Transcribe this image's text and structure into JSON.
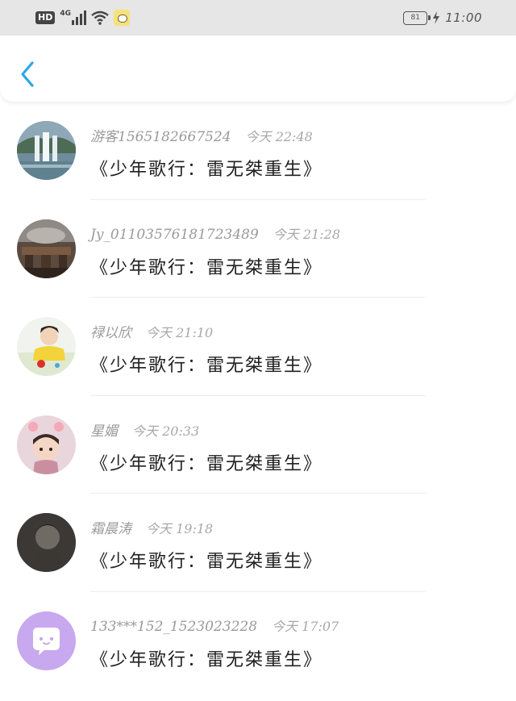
{
  "status_bar": {
    "hd_label": "HD",
    "network_label": "4G",
    "battery_level": "81",
    "time": "11:00"
  },
  "header": {
    "back_icon": "chevron-left-icon",
    "accent": "#2aa7e8"
  },
  "messages": [
    {
      "name": "游客1565182667524",
      "time": "今天 22:48",
      "text": "《少年歌行：雷无桀重生》",
      "avatar": "waterfall-photo"
    },
    {
      "name": "Jy_01103576181723489",
      "time": "今天 21:28",
      "text": "《少年歌行：雷无桀重生》",
      "avatar": "room-photo"
    },
    {
      "name": "禄以欣",
      "time": "今天 21:10",
      "text": "《少年歌行：雷无桀重生》",
      "avatar": "child-photo"
    },
    {
      "name": "星媚",
      "time": "今天 20:33",
      "text": "《少年歌行：雷无桀重生》",
      "avatar": "girl-photo"
    },
    {
      "name": "霜晨涛",
      "time": "今天 19:18",
      "text": "《少年歌行：雷无桀重生》",
      "avatar": "dark-photo"
    },
    {
      "name": "133***152_1523023228",
      "time": "今天 17:07",
      "text": "《少年歌行：雷无桀重生》",
      "avatar": "chat-bubble-icon"
    }
  ]
}
